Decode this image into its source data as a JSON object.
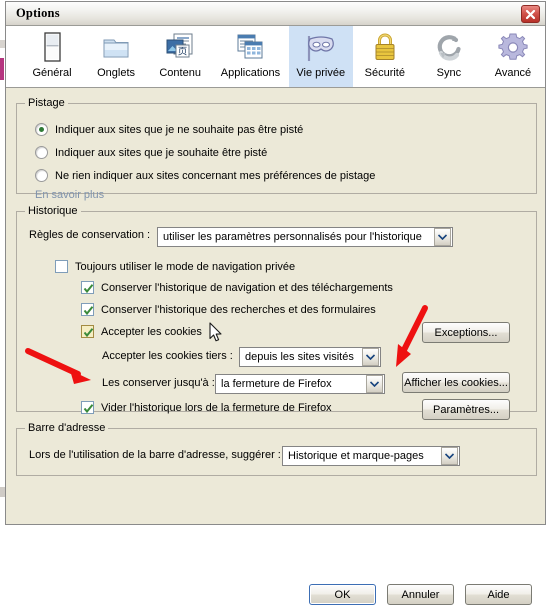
{
  "window": {
    "title": "Options",
    "close_icon": "close-icon"
  },
  "tabs": [
    {
      "label": "Général",
      "icon": "general-panel-icon",
      "selected": false
    },
    {
      "label": "Onglets",
      "icon": "folder-tabs-icon",
      "selected": false
    },
    {
      "label": "Contenu",
      "icon": "content-page-icon",
      "selected": false
    },
    {
      "label": "Applications",
      "icon": "applications-windows-icon",
      "selected": false
    },
    {
      "label": "Vie privée",
      "icon": "privacy-mask-icon",
      "selected": true
    },
    {
      "label": "Sécurité",
      "icon": "padlock-icon",
      "selected": false
    },
    {
      "label": "Sync",
      "icon": "sync-arrows-icon",
      "selected": false
    },
    {
      "label": "Avancé",
      "icon": "gear-icon",
      "selected": false
    }
  ],
  "pistage": {
    "legend": "Pistage",
    "options": [
      {
        "label": "Indiquer aux sites que je ne souhaite pas être pisté",
        "checked": true
      },
      {
        "label": "Indiquer aux sites que je souhaite être pisté",
        "checked": false
      },
      {
        "label": "Ne rien indiquer aux sites concernant mes préférences de pistage",
        "checked": false
      }
    ],
    "learn_more": "En savoir plus"
  },
  "historique": {
    "legend": "Historique",
    "rules_label": "Règles de conservation :",
    "rules_value": "utiliser les paramètres personnalisés pour l'historique",
    "private_mode": {
      "label": "Toujours utiliser le mode de navigation privée",
      "checked": false
    },
    "keep_browsing": {
      "label": "Conserver l'historique de navigation et des téléchargements",
      "checked": true
    },
    "keep_search": {
      "label": "Conserver l'historique des recherches et des formulaires",
      "checked": true
    },
    "accept_cookies": {
      "label": "Accepter les cookies",
      "checked": true
    },
    "third_party_label": "Accepter les cookies tiers :",
    "third_party_value": "depuis les sites visités",
    "keep_until_label": "Les conserver jusqu'à :",
    "keep_until_value": "la fermeture de Firefox",
    "clear_on_close": {
      "label": "Vider l'historique lors de la fermeture de Firefox",
      "checked": true
    },
    "exceptions_button": "Exceptions...",
    "show_cookies_button": "Afficher les cookies...",
    "settings_button": "Paramètres..."
  },
  "adresse": {
    "legend": "Barre d'adresse",
    "label": "Lors de l'utilisation de la barre d'adresse, suggérer :",
    "value": "Historique et marque-pages"
  },
  "footer": {
    "ok": "OK",
    "cancel": "Annuler",
    "help": "Aide"
  },
  "annotations": {
    "arrow_color": "#ee1111",
    "arrow_left_target": "Les conserver jusqu'à :",
    "arrow_right_target": "Afficher les cookies..."
  },
  "colors": {
    "window_background": "#ece9d8",
    "selected_tab": "#cfe1f5",
    "link": "#7f93ad",
    "radio_dot": "#2f7a36",
    "check_mark": "#3a8a3a",
    "close_button": "#c2382f"
  }
}
